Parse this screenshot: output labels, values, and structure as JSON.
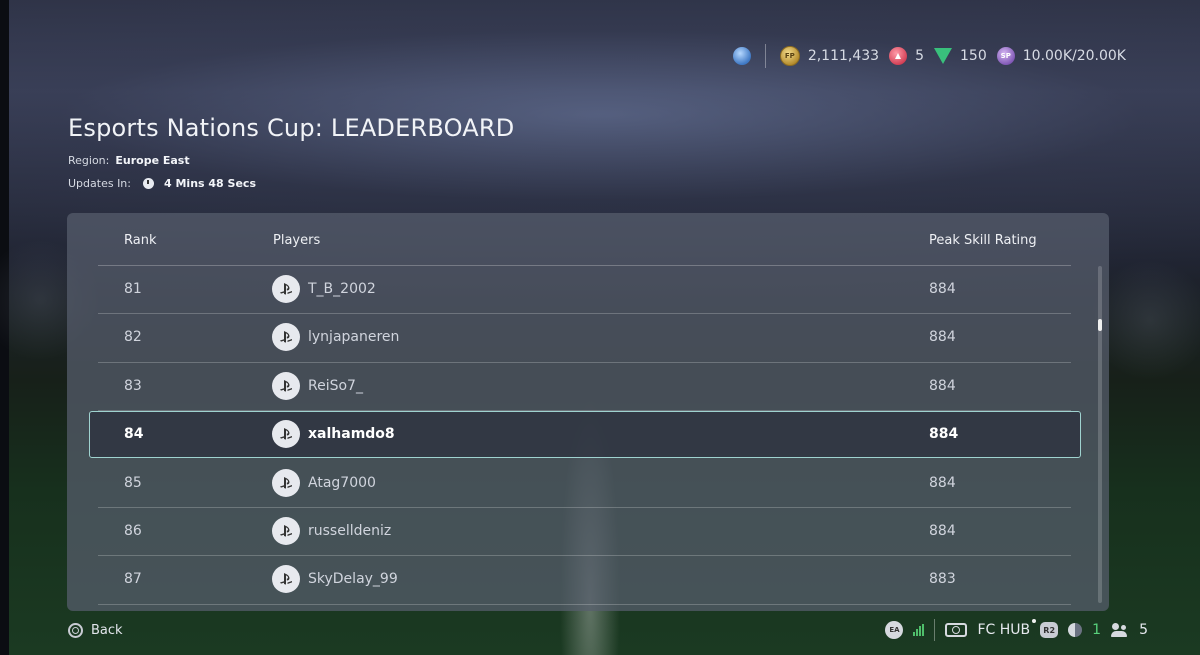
{
  "currency": {
    "coins": "2,111,433",
    "points": "5",
    "tokens": "150",
    "season_progress": "10.00K/20.00K",
    "icons": [
      "region-globe-icon",
      "coins-icon",
      "fc-points-icon",
      "tokens-icon",
      "sp-icon"
    ],
    "coin_icon_text": "FP",
    "sp_icon_text": "SP"
  },
  "header": {
    "title": "Esports Nations Cup: LEADERBOARD",
    "region_label": "Region:",
    "region_value": "Europe East",
    "updates_label": "Updates In:",
    "updates_value": "4 Mins 48 Secs"
  },
  "table": {
    "columns": [
      "Rank",
      "Players",
      "Peak Skill Rating"
    ],
    "selected_rank": "84",
    "rows": [
      {
        "rank": "81",
        "player": "T_B_2002",
        "rating": "884"
      },
      {
        "rank": "82",
        "player": "lynjapaneren",
        "rating": "884"
      },
      {
        "rank": "83",
        "player": "ReiSo7_",
        "rating": "884"
      },
      {
        "rank": "84",
        "player": "xalhamdo8",
        "rating": "884"
      },
      {
        "rank": "85",
        "player": "Atag7000",
        "rating": "884"
      },
      {
        "rank": "86",
        "player": "russelldeniz",
        "rating": "884"
      },
      {
        "rank": "87",
        "player": "SkyDelay_99",
        "rating": "883"
      }
    ]
  },
  "footer": {
    "back_label": "Back",
    "ea_label": "EA",
    "hub_label": "FC HUB",
    "r2_label": "R2",
    "online_count": "1",
    "friends_count": "5"
  },
  "colors": {
    "selection_border": "#9fd3d0",
    "online_green": "#58d27c",
    "coin_gold": "#b2892a",
    "points_red": "#d13c52",
    "tokens_green": "#39c07c",
    "sp_purple": "#7d54b3"
  }
}
